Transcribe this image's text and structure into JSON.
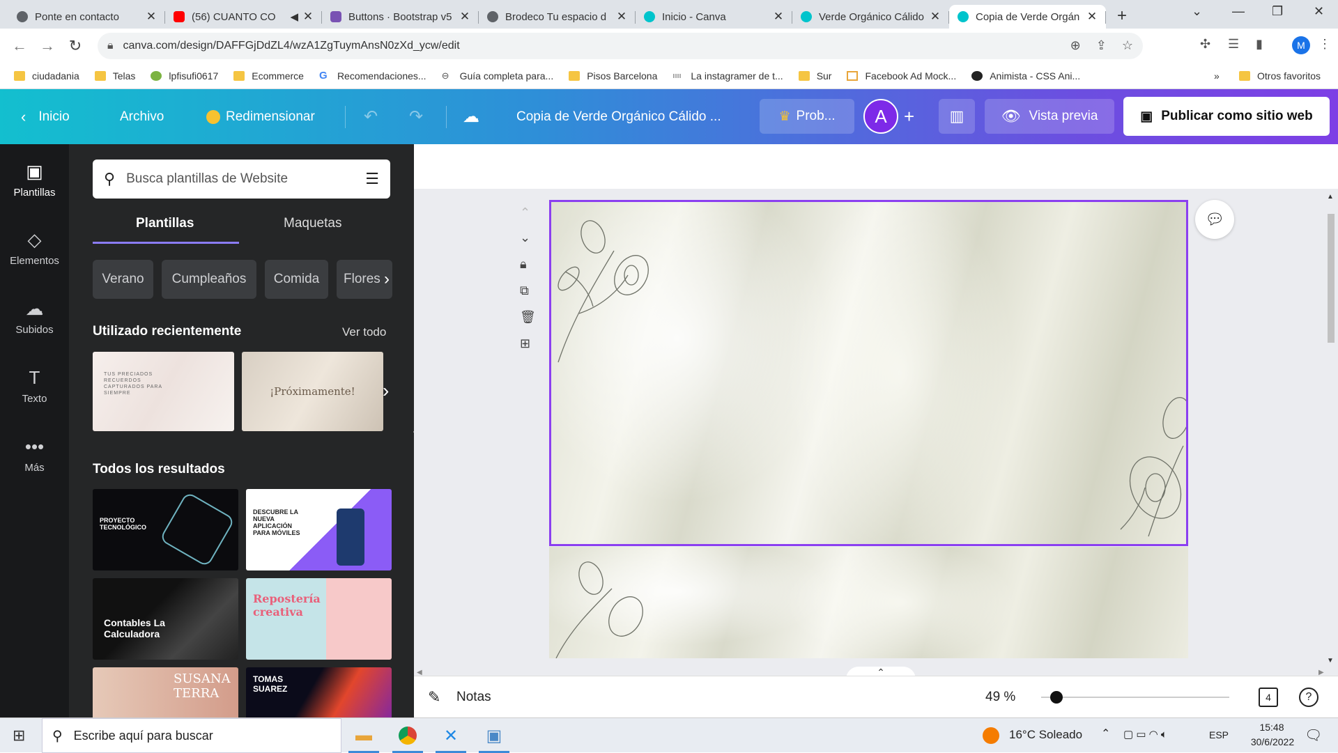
{
  "browser": {
    "tabs": [
      {
        "title": "Ponte en contacto",
        "fav_color": "#5f6368"
      },
      {
        "title": "(56) CUANTO CO",
        "fav_color": "#ff0000"
      },
      {
        "title": "Buttons · Bootstrap v5",
        "fav_color": "#7952b3"
      },
      {
        "title": "Brodeco Tu espacio d",
        "fav_color": "#5f6368"
      },
      {
        "title": "Inicio - Canva",
        "fav_color": "#00c4cc"
      },
      {
        "title": "Verde Orgánico Cálido",
        "fav_color": "#00c4cc"
      },
      {
        "title": "Copia de Verde Orgán",
        "fav_color": "#00c4cc"
      }
    ],
    "url": "canva.com/design/DAFFGjDdZL4/wzA1ZgTuymAnsN0zXd_ycw/edit",
    "profile_initial": "M",
    "bookmarks": [
      "ciudadania",
      "Telas",
      "lpfisufi0617",
      "Ecommerce",
      "Recomendaciones...",
      "Guía completa para...",
      "Pisos Barcelona",
      "La instagramer de t...",
      "Sur",
      "Facebook Ad Mock...",
      "Animista - CSS Ani..."
    ],
    "bookmarks_more": "»",
    "other_favorites": "Otros favoritos"
  },
  "header": {
    "home": "Inicio",
    "file": "Archivo",
    "resize": "Redimensionar",
    "design_title": "Copia de Verde Orgánico Cálido ...",
    "pro_label": "Prob...",
    "user_initial": "A",
    "preview": "Vista previa",
    "publish": "Publicar como sitio web"
  },
  "rail": [
    {
      "label": "Plantillas",
      "icon": "▣"
    },
    {
      "label": "Elementos",
      "icon": "◇"
    },
    {
      "label": "Subidos",
      "icon": "☁"
    },
    {
      "label": "Texto",
      "icon": "T"
    },
    {
      "label": "Más",
      "icon": "•••"
    }
  ],
  "panel": {
    "search_placeholder": "Busca plantillas de Website",
    "tabs": [
      "Plantillas",
      "Maquetas"
    ],
    "chips": [
      "Verano",
      "Cumpleaños",
      "Comida",
      "Flores"
    ],
    "recent_title": "Utilizado recientemente",
    "see_all": "Ver todo",
    "recent": [
      {
        "caption": "TUS PRECIADOS RECUERDOS CAPTURADOS PARA SIEMPRE"
      },
      {
        "caption": "¡Próximamente!"
      }
    ],
    "all_title": "Todos los resultados",
    "results": [
      {
        "caption": "PROYECTO TECNOLÓGICO"
      },
      {
        "caption": "DESCUBRE LA NUEVA APLICACIÓN PARA MÓVILES"
      },
      {
        "caption": "Contables La Calculadora"
      },
      {
        "caption": "Repostería creativa"
      },
      {
        "caption": "SUSANA TERRA"
      },
      {
        "caption": "TOMAS SUAREZ"
      }
    ]
  },
  "bottom": {
    "notes": "Notas",
    "zoom": "49 %",
    "zoom_fraction": 0.08,
    "pages": "4",
    "help": "?"
  },
  "taskbar": {
    "search": "Escribe aquí para buscar",
    "weather": "16°C  Soleado",
    "lang": "ESP",
    "time": "15:48",
    "date": "30/6/2022"
  }
}
